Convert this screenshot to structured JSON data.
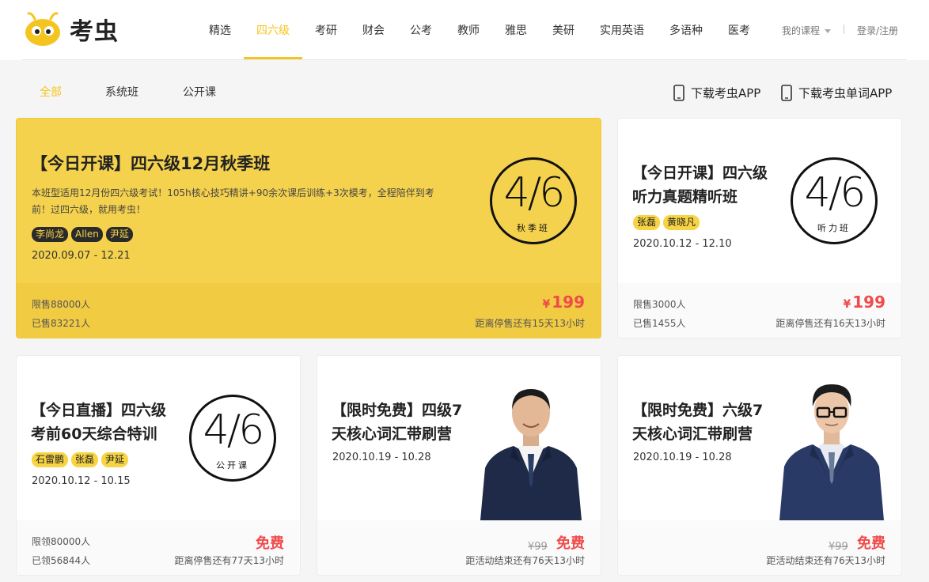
{
  "header": {
    "logo_text": "考虫",
    "nav": [
      "精选",
      "四六级",
      "考研",
      "财会",
      "公考",
      "教师",
      "雅思",
      "美研",
      "实用英语",
      "多语种",
      "医考"
    ],
    "active_nav": "四六级",
    "my_course": "我的课程",
    "login": "登录/注册"
  },
  "subtabs": {
    "items": [
      "全部",
      "系统班",
      "公开课"
    ],
    "active": "全部"
  },
  "downloads": {
    "app": "下载考虫APP",
    "word_app": "下载考虫单词APP"
  },
  "colors": {
    "accent": "#f5c51f",
    "featured_bg": "#f5d24d",
    "price_red": "#f04b4b"
  },
  "cards": [
    {
      "title": "【今日开课】四六级12月秋季班",
      "desc": "本班型适用12月份四六级考试！105h核心技巧精讲+90余次课后训练+3次模考，全程陪伴到考前！过四六级，就用考虫！",
      "teachers": [
        "李尚龙",
        "Allen",
        "尹延"
      ],
      "dates": "2020.09.07 - 12.21",
      "badge_big": "4/6",
      "badge_small": "秋季班",
      "quota": "限售88000人",
      "sold": "已售83221人",
      "price_symbol": "¥",
      "price": "199",
      "countdown": "距离停售还有15天13小时"
    },
    {
      "title_line1": "【今日开课】四六级",
      "title_line2": "听力真题精听班",
      "teachers": [
        "张磊",
        "黄晓凡"
      ],
      "dates": "2020.10.12 - 12.10",
      "badge_big": "4/6",
      "badge_small": "听力班",
      "quota": "限售3000人",
      "sold": "已售1455人",
      "price_symbol": "¥",
      "price": "199",
      "countdown": "距离停售还有16天13小时"
    },
    {
      "title_line1": "【今日直播】四六级",
      "title_line2": "考前60天综合特训",
      "teachers": [
        "石雷鹏",
        "张磊",
        "尹延"
      ],
      "dates": "2020.10.12 - 10.15",
      "badge_big": "4/6",
      "badge_small": "公开课",
      "quota": "限领80000人",
      "sold": "已领56844人",
      "free": "免费",
      "countdown": "距离停售还有77天13小时"
    },
    {
      "title_line1": "【限时免费】四级7",
      "title_line2": "天核心词汇带刷营",
      "dates": "2020.10.19 - 10.28",
      "orig_price": "¥99",
      "free": "免费",
      "countdown": "距活动结束还有76天13小时"
    },
    {
      "title_line1": "【限时免费】六级7",
      "title_line2": "天核心词汇带刷营",
      "dates": "2020.10.19 - 10.28",
      "orig_price": "¥99",
      "free": "免费",
      "countdown": "距活动结束还有76天13小时"
    }
  ]
}
